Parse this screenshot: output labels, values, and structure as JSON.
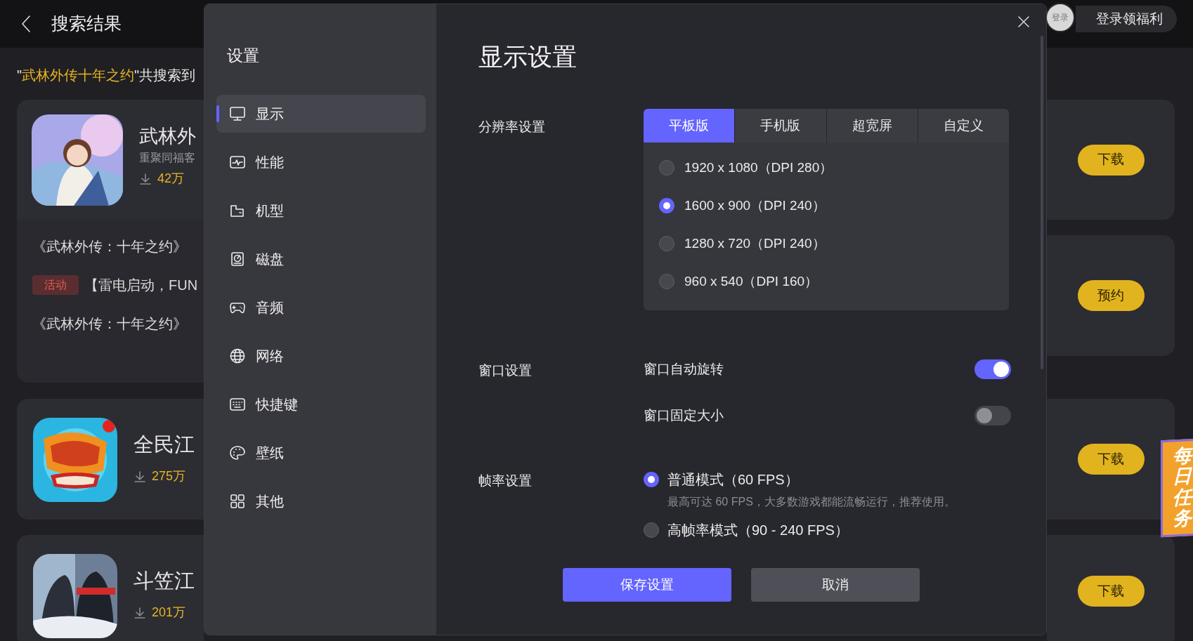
{
  "header": {
    "title": "搜索结果"
  },
  "login": {
    "avatar_label": "登录",
    "button": "登录领福利"
  },
  "summary": {
    "open_quote": "\"",
    "query": "武林外传十年之约",
    "rest": "\"共搜索到"
  },
  "results": [
    {
      "kind": "game",
      "title": "武林外",
      "subtitle": "重聚同福客",
      "downloads": "42万",
      "action": "下载"
    },
    {
      "kind": "news",
      "lines": [
        {
          "text": "《武林外传：十年之约》"
        },
        {
          "tag": "活动",
          "text": "【雷电启动，FUN"
        },
        {
          "text": "《武林外传：十年之约》"
        }
      ],
      "action": "预约"
    },
    {
      "kind": "game",
      "title": "全民江",
      "downloads": "275万",
      "action": "下载"
    },
    {
      "kind": "game",
      "title": "斗笠江",
      "downloads": "201万",
      "action": "下载"
    }
  ],
  "daily_task": "每日任务",
  "settings": {
    "sidebar_title": "设置",
    "nav": [
      {
        "label": "显示",
        "selected": true
      },
      {
        "label": "性能",
        "selected": false
      },
      {
        "label": "机型",
        "selected": false
      },
      {
        "label": "磁盘",
        "selected": false
      },
      {
        "label": "音频",
        "selected": false
      },
      {
        "label": "网络",
        "selected": false
      },
      {
        "label": "快捷键",
        "selected": false
      },
      {
        "label": "壁纸",
        "selected": false
      },
      {
        "label": "其他",
        "selected": false
      }
    ],
    "page_title": "显示设置",
    "resolution": {
      "label": "分辨率设置",
      "tabs": [
        {
          "label": "平板版",
          "selected": true
        },
        {
          "label": "手机版",
          "selected": false
        },
        {
          "label": "超宽屏",
          "selected": false
        },
        {
          "label": "自定义",
          "selected": false
        }
      ],
      "options": [
        {
          "label": "1920 x 1080（DPI 280）",
          "selected": false
        },
        {
          "label": "1600 x 900（DPI 240）",
          "selected": true
        },
        {
          "label": "1280 x 720（DPI 240）",
          "selected": false
        },
        {
          "label": "960 x 540（DPI 160）",
          "selected": false
        }
      ]
    },
    "window": {
      "label": "窗口设置",
      "toggles": [
        {
          "label": "窗口自动旋转",
          "on": true
        },
        {
          "label": "窗口固定大小",
          "on": false
        }
      ]
    },
    "frame_rate": {
      "label": "帧率设置",
      "options": [
        {
          "label": "普通模式（60 FPS）",
          "hint": "最高可达 60 FPS，大多数游戏都能流畅运行，推荐使用。",
          "selected": true
        },
        {
          "label": "高帧率模式（90 - 240 FPS）",
          "selected": false
        }
      ]
    },
    "buttons": [
      {
        "label": "保存设置",
        "kind": "primary"
      },
      {
        "label": "取消",
        "kind": "secondary"
      }
    ]
  }
}
